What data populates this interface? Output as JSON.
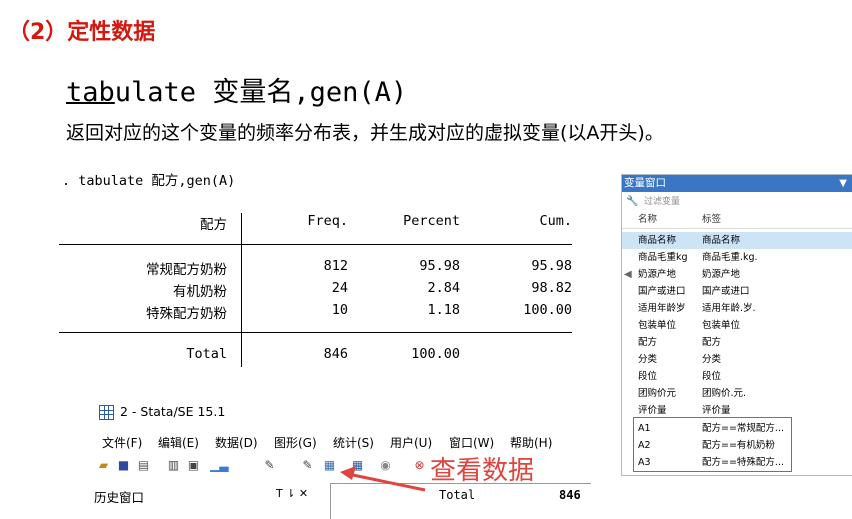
{
  "heading": "（2）定性数据",
  "command": {
    "underlined": "tab",
    "rest": "ulate",
    "varname": "变量名",
    "suffix": ",gen(A)"
  },
  "description": "返回对应的这个变量的频率分布表，并生成对应的虚拟变量(以A开头)。",
  "stata_command": ". tabulate 配方,gen(A)",
  "table": {
    "headers": [
      "配方",
      "Freq.",
      "Percent",
      "Cum."
    ],
    "rows": [
      [
        "常规配方奶粉",
        "812",
        "95.98",
        "95.98"
      ],
      [
        "有机奶粉",
        "24",
        "2.84",
        "98.82"
      ],
      [
        "特殊配方奶粉",
        "10",
        "1.18",
        "100.00"
      ]
    ],
    "total": [
      "Total",
      "846",
      "100.00"
    ]
  },
  "variable_window": {
    "title": "变量窗口",
    "pin_icon": "filter-pin-icon",
    "filter_placeholder": "过滤变量",
    "col_name": "名称",
    "col_label": "标签",
    "rows": [
      [
        "商品名称",
        "商品名称"
      ],
      [
        "商品毛重kg",
        "商品毛重.kg."
      ],
      [
        "奶源产地",
        "奶源产地"
      ],
      [
        "国产或进口",
        "国产或进口"
      ],
      [
        "适用年龄岁",
        "适用年龄.岁."
      ],
      [
        "包装单位",
        "包装单位"
      ],
      [
        "配方",
        "配方"
      ],
      [
        "分类",
        "分类"
      ],
      [
        "段位",
        "段位"
      ],
      [
        "团购价元",
        "团购价.元."
      ],
      [
        "评价量",
        "评价量"
      ],
      [
        "A1",
        "配方==常规配方..."
      ],
      [
        "A2",
        "配方==有机奶粉"
      ],
      [
        "A3",
        "配方==特殊配方..."
      ]
    ],
    "highlight_color": "#e0443e"
  },
  "stata_window": {
    "title": "2 - Stata/SE 15.1",
    "menus": [
      "文件(F)",
      "编辑(E)",
      "数据(D)",
      "图形(G)",
      "统计(S)",
      "用户(U)",
      "窗口(W)",
      "帮助(H)"
    ],
    "history_title": "历史窗口",
    "history_controls": "T ⇂ ✕",
    "result_label": "Total",
    "result_value": "846"
  },
  "annotation": "查看数据",
  "colors": {
    "heading": "#d4170f",
    "titlebar": "#3b76c4",
    "annotation": "#e0443e"
  }
}
